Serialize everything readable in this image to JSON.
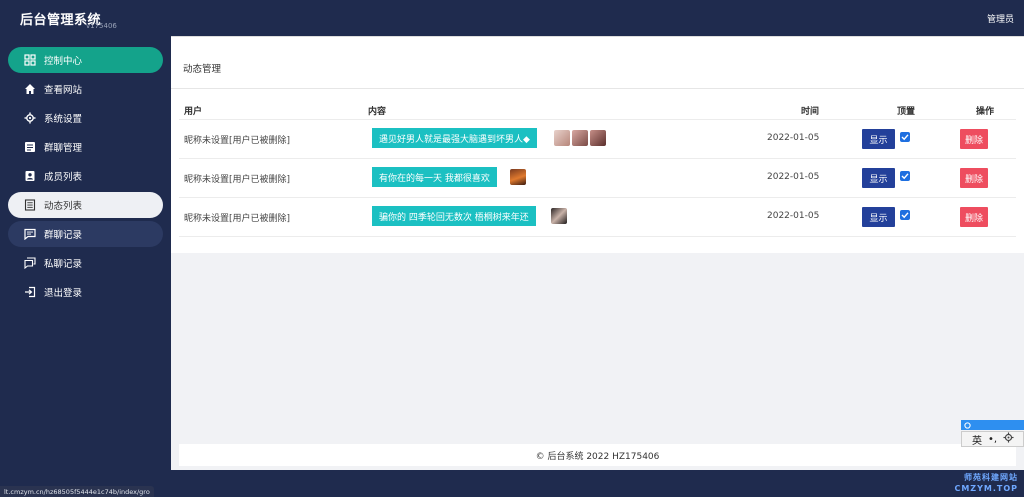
{
  "header": {
    "brand": "后台管理系统",
    "version": "v175406",
    "user": "管理员"
  },
  "sidebar": {
    "items": [
      {
        "label": "控制中心",
        "icon": "dashboard-icon",
        "state": "active"
      },
      {
        "label": "查看网站",
        "icon": "home-icon",
        "state": "normal"
      },
      {
        "label": "系统设置",
        "icon": "gear-icon",
        "state": "normal"
      },
      {
        "label": "群聊管理",
        "icon": "message-icon",
        "state": "normal"
      },
      {
        "label": "成员列表",
        "icon": "contacts-icon",
        "state": "normal"
      },
      {
        "label": "动态列表",
        "icon": "list-icon",
        "state": "selected"
      },
      {
        "label": "群聊记录",
        "icon": "chat-icon",
        "state": "hover"
      },
      {
        "label": "私聊记录",
        "icon": "chats-icon",
        "state": "normal"
      },
      {
        "label": "退出登录",
        "icon": "logout-icon",
        "state": "normal"
      }
    ]
  },
  "panel": {
    "title": "动态管理",
    "columns": {
      "user": "用户",
      "content": "内容",
      "time": "时间",
      "pin": "顶置",
      "actions": "操作"
    },
    "rows": [
      {
        "user": "昵称未设置[用户已被删除]",
        "content": "遇见好男人就是最强大脑遇到坏男人◆",
        "time": "2022-01-05",
        "show": "显示",
        "delete": "删除",
        "pinned": true
      },
      {
        "user": "昵称未设置[用户已被删除]",
        "content": "有你在的每一天 我都很喜欢",
        "time": "2022-01-05",
        "show": "显示",
        "delete": "删除",
        "pinned": true
      },
      {
        "user": "昵称未设置[用户已被删除]",
        "content": "骗你的 四季轮回无数次 梧桐树来年还",
        "time": "2022-01-05",
        "show": "显示",
        "delete": "删除",
        "pinned": true
      }
    ]
  },
  "footer": {
    "text": "© 后台系统 2022 HZ175406"
  },
  "statusbar": {
    "url": "lt.cmzym.cn/hz68505f5444e1c74b/index/gro"
  },
  "ime": {
    "mode": "英",
    "punct": "•,"
  },
  "watermark": {
    "line1": "师苑科建网站",
    "line2": "CMZYM.TOP"
  },
  "colors": {
    "accent": "#14a38b",
    "sidebar": "#1f2b4e",
    "tag": "#1bc0c2",
    "show_button": "#23409a",
    "delete_button": "#ee4d5f"
  }
}
